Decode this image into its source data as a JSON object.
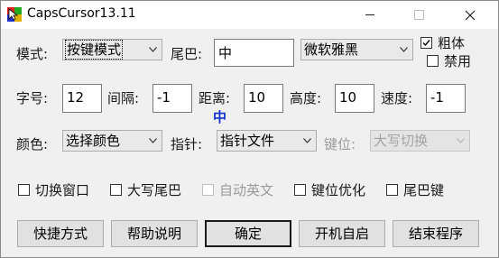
{
  "window": {
    "title": "CapsCursor13.11"
  },
  "row1": {
    "mode_label": "模式:",
    "mode_value": "按键模式",
    "tail_label": "尾巴:",
    "tail_value": "中",
    "font_value": "微软雅黑",
    "bold_label": "粗体",
    "bold_checked": true,
    "disable_label": "禁用",
    "disable_checked": false
  },
  "row2": {
    "size_label": "字号:",
    "size_value": "12",
    "gap_label": "间隔:",
    "gap_value": "-1",
    "dist_label": "距离:",
    "dist_value": "10",
    "height_label": "高度:",
    "height_value": "10",
    "speed_label": "速度:",
    "speed_value": "-1",
    "marker_text": "中",
    "marker_color": "#1133cc"
  },
  "row3": {
    "color_label": "颜色:",
    "color_value": "选择颜色",
    "pointer_label": "指针:",
    "pointer_value": "指针文件",
    "key_label": "键位:",
    "key_value": "大写切换"
  },
  "options": [
    {
      "label": "切换窗口",
      "checked": false,
      "enabled": true
    },
    {
      "label": "大写尾巴",
      "checked": false,
      "enabled": true
    },
    {
      "label": "自动英文",
      "checked": false,
      "enabled": false
    },
    {
      "label": "键位优化",
      "checked": false,
      "enabled": true
    },
    {
      "label": "尾巴键",
      "checked": false,
      "enabled": true
    }
  ],
  "buttons": {
    "shortcut": "快捷方式",
    "help": "帮助说明",
    "ok": "确定",
    "autostart": "开机自启",
    "exit": "结束程序"
  }
}
